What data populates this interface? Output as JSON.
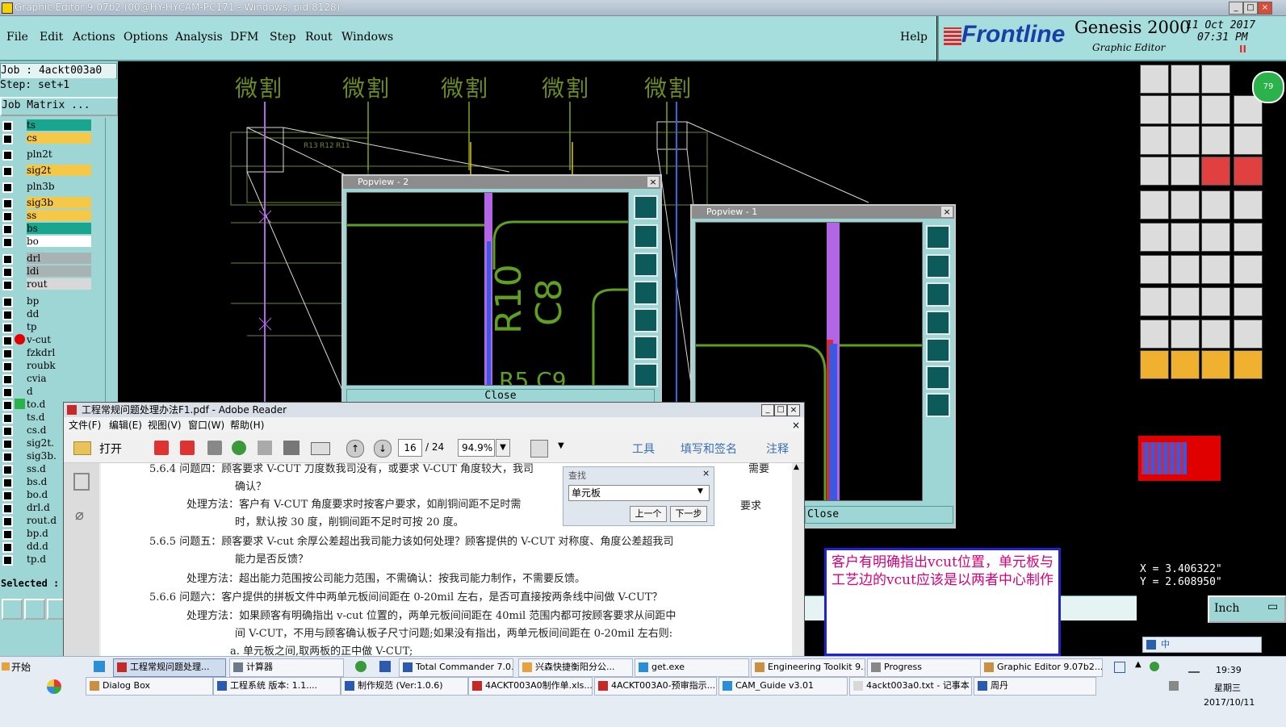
{
  "window": {
    "title": "Graphic Editor 9.07b2 (00@HY-HYCAM-PC171 - Windows, pid:8128)",
    "min": "_",
    "max": "□",
    "close": "×"
  },
  "menu": [
    "File",
    "Edit",
    "Actions",
    "Options",
    "Analysis",
    "DFM",
    "Step",
    "Rout",
    "Windows"
  ],
  "help": "Help",
  "brand": {
    "logo": "Frontline",
    "product": "Genesis 2000",
    "subtitle": "Graphic Editor",
    "date": "11 Oct 2017",
    "time": "07:31 PM",
    "mark": "II"
  },
  "left": {
    "job": "Job : 4ackt003a0",
    "step": "Step: set+1",
    "matrix": "Job Matrix ...",
    "selected": "Selected :",
    "layers": [
      {
        "name": "ts",
        "color": "#1aa58e"
      },
      {
        "name": "cs",
        "color": "#f6c84a"
      },
      {
        "name": "pln2t",
        "color": "#9ed6d6"
      },
      {
        "name": "sig2t",
        "color": "#f6c84a"
      },
      {
        "name": "pln3b",
        "color": "#9ed6d6"
      },
      {
        "name": "sig3b",
        "color": "#f6c84a"
      },
      {
        "name": "ss",
        "color": "#f6c84a"
      },
      {
        "name": "bs",
        "color": "#1aa58e"
      },
      {
        "name": "bo",
        "color": "#ffffff"
      },
      {
        "name": "drl",
        "color": "#a9b3b3"
      },
      {
        "name": "ldi",
        "color": "#a9b3b3"
      },
      {
        "name": "rout",
        "color": "#d8d8d8"
      },
      {
        "name": "bp",
        "color": "#9ed6d6"
      },
      {
        "name": "dd",
        "color": "#9ed6d6"
      },
      {
        "name": "tp",
        "color": "#9ed6d6"
      },
      {
        "name": "v-cut",
        "color": "#9ed6d6"
      },
      {
        "name": "fzkdrl",
        "color": "#9ed6d6"
      },
      {
        "name": "roubk",
        "color": "#9ed6d6"
      },
      {
        "name": "cvia",
        "color": "#9ed6d6"
      },
      {
        "name": "d",
        "color": "#9ed6d6"
      },
      {
        "name": "to.d",
        "color": "#9ed6d6"
      },
      {
        "name": "ts.d",
        "color": "#9ed6d6"
      },
      {
        "name": "cs.d",
        "color": "#9ed6d6"
      },
      {
        "name": "sig2t.",
        "color": "#9ed6d6"
      },
      {
        "name": "sig3b.",
        "color": "#9ed6d6"
      },
      {
        "name": "ss.d",
        "color": "#9ed6d6"
      },
      {
        "name": "bs.d",
        "color": "#9ed6d6"
      },
      {
        "name": "bo.d",
        "color": "#9ed6d6"
      },
      {
        "name": "drl.d",
        "color": "#9ed6d6"
      },
      {
        "name": "rout.d",
        "color": "#9ed6d6"
      },
      {
        "name": "bp.d",
        "color": "#9ed6d6"
      },
      {
        "name": "dd.d",
        "color": "#9ed6d6"
      },
      {
        "name": "tp.d",
        "color": "#9ed6d6"
      }
    ]
  },
  "canvas": {
    "labels": [
      "微割",
      "微割",
      "微割",
      "微割",
      "微割"
    ],
    "silk": [
      "R13",
      "R12",
      "R11"
    ]
  },
  "popview2": {
    "title": "Popview - 2",
    "close": "Close",
    "text1": "R10",
    "text2": "C8",
    "text3": "R5 C9"
  },
  "popview1": {
    "title": "Popview - 1",
    "close": "Close"
  },
  "coords": {
    "x": "X = 3.406322\"",
    "y": "Y = 2.608950\""
  },
  "unit": "Inch",
  "note": "客户有明确指出vcut位置，单元板与工艺边的vcut应该是以两者中心制作",
  "reader": {
    "title": "工程常规问题处理办法F1.pdf - Adobe Reader",
    "menu": [
      "文件(F)",
      "编辑(E)",
      "视图(V)",
      "窗口(W)",
      "帮助(H)"
    ],
    "open": "打开",
    "page": "16",
    "pages": "/ 24",
    "zoom": "94.9%",
    "tools": "工具",
    "sign": "填写和签名",
    "comment": "注释",
    "find_title": "查找",
    "find_value": "单元板",
    "prev": "上一个",
    "next": "下一步",
    "lines": [
      "5.6.4 问题四：顾客要求 V-CUT 刀度数我司没有，或要求 V-CUT 角度较大，我司",
      "确认？",
      "处理方法：客户有 V-CUT 角度要求时按客户要求，如削铜间距不足时需",
      "时，默认按 30 度，削铜间距不足时可按 20 度。",
      "5.6.5 问题五：顾客要求 V-cut 余厚公差超出我司能力该如何处理？顾客提供的 V-CUT 对称度、角度公差超我司",
      "能力是否反馈？",
      "处理方法：超出能力范围按公司能力范围，不需确认：按我司能力制作，不需要反馈。",
      "5.6.6 问题六：客户提供的拼板文件中两单元板间间距在 0-20mil 左右，是否可直接按两条线中间做 V-CUT？",
      "处理方法：如果顾客有明确指出 v-cut 位置的，两单元板间间距在 40mil 范围内都可按顾客要求从间距中",
      "间 V-CUT，不用与顾客确认板子尺寸问题;如果没有指出，两单元板间间距在 0-20mil 左右则:",
      "a. 单元板之间,取两板的正中做 V-CUT;"
    ],
    "tail1": "需要",
    "tail2": "要求"
  },
  "taskbar": {
    "start": "开始",
    "row1": [
      "工程常规问题处理...",
      "计算器",
      "Total Commander 7.0...",
      "兴森快捷衡阳分公...",
      "get.exe",
      "Engineering Toolkit 9....",
      "Progress",
      "Graphic Editor 9.07b2..."
    ],
    "row2": [
      "Dialog Box",
      "工程系统  版本: 1.1....",
      "制作规范 (Ver:1.0.6)",
      "4ACKT003A0制作单.xls...",
      "4ACKT003A0-预审指示...",
      "CAM_Guide v3.01",
      "4ackt003a0.txt - 记事本",
      "周丹"
    ],
    "ime": "中",
    "time": "19:39",
    "weekday": "星期三",
    "date": "2017/10/11"
  }
}
